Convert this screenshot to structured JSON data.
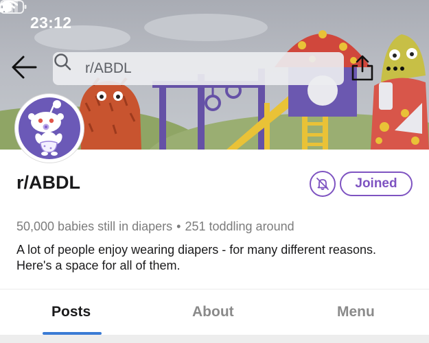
{
  "status_bar": {
    "time": "23:12"
  },
  "search": {
    "query": "r/ABDL"
  },
  "subreddit": {
    "name": "r/ABDL",
    "joined_label": "Joined",
    "members_text": "50,000 babies still in diapers",
    "separator": "•",
    "online_text": "251 toddling around",
    "description": "A lot of people enjoy wearing diapers - for many different reasons. Here's a space for all of them."
  },
  "tabs": [
    {
      "label": "Posts",
      "active": true
    },
    {
      "label": "About",
      "active": false
    },
    {
      "label": "Menu",
      "active": false
    }
  ],
  "colors": {
    "accent": "#7e53c1",
    "tab_indicator": "#3a7bd5",
    "avatar_bg": "#6b59b7"
  },
  "icons": [
    "back-arrow-icon",
    "search-icon",
    "share-icon",
    "more-icon",
    "bell-off-icon",
    "location-arrow-icon",
    "signal-icon",
    "wifi-icon",
    "battery-icon"
  ]
}
